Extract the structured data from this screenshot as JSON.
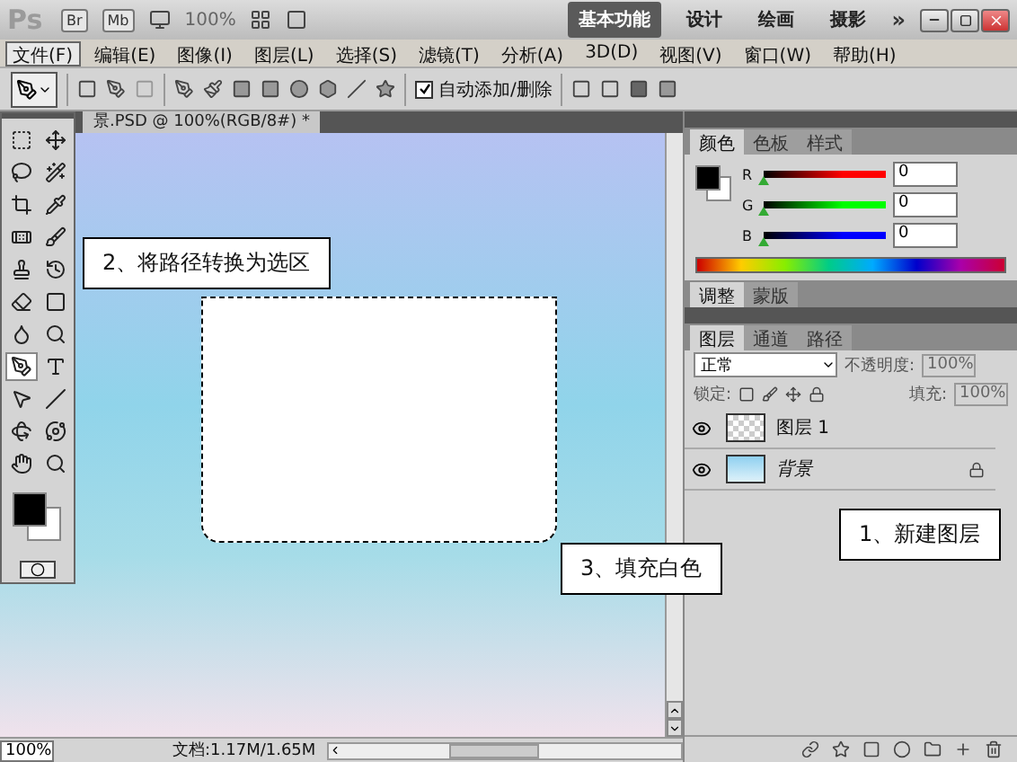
{
  "app_bar": {
    "logo": "Ps",
    "bridge": "Br",
    "mini_bridge": "Mb",
    "zoom": "100%",
    "workspaces": [
      {
        "label": "基本功能",
        "selected": true
      },
      {
        "label": "设计",
        "selected": false
      },
      {
        "label": "绘画",
        "selected": false
      },
      {
        "label": "摄影",
        "selected": false
      }
    ],
    "more": "»"
  },
  "menu": [
    {
      "label": "文件(F)",
      "selected": true
    },
    {
      "label": "编辑(E)",
      "selected": false
    },
    {
      "label": "图像(I)",
      "selected": false
    },
    {
      "label": "图层(L)",
      "selected": false
    },
    {
      "label": "选择(S)",
      "selected": false
    },
    {
      "label": "滤镜(T)",
      "selected": false
    },
    {
      "label": "分析(A)",
      "selected": false
    },
    {
      "label": "3D(D)",
      "selected": false
    },
    {
      "label": "视图(V)",
      "selected": false
    },
    {
      "label": "窗口(W)",
      "selected": false
    },
    {
      "label": "帮助(H)",
      "selected": false
    }
  ],
  "options_bar": {
    "auto_add_delete": {
      "label": "自动添加/删除",
      "checked": true
    }
  },
  "document": {
    "tab_title": "景.PSD @ 100%(RGB/8#) *",
    "zoom": "100%",
    "doc_info": "文档:1.17M/1.65M"
  },
  "annotations": [
    {
      "text": "2、将路径转换为选区"
    },
    {
      "text": "3、填充白色"
    },
    {
      "text": "1、新建图层"
    }
  ],
  "color_panel": {
    "tabs": [
      {
        "label": "颜色",
        "selected": true
      },
      {
        "label": "色板",
        "selected": false
      },
      {
        "label": "样式",
        "selected": false
      }
    ],
    "channels": [
      {
        "label": "R",
        "value": "0",
        "level": 0,
        "color": "#ff0000"
      },
      {
        "label": "G",
        "value": "0",
        "level": 0,
        "color": "#00ff00"
      },
      {
        "label": "B",
        "value": "0",
        "level": 0,
        "color": "#0000ff"
      }
    ]
  },
  "adjust_panel": {
    "tabs": [
      {
        "label": "调整",
        "selected": true
      },
      {
        "label": "蒙版",
        "selected": false
      }
    ]
  },
  "layers_panel": {
    "tabs": [
      {
        "label": "图层",
        "selected": true
      },
      {
        "label": "通道",
        "selected": false
      },
      {
        "label": "路径",
        "selected": false
      }
    ],
    "blend_mode": "正常",
    "opacity_label": "不透明度:",
    "opacity": "100%",
    "lock_label": "锁定:",
    "fill_label": "填充:",
    "fill": "100%",
    "layers": [
      {
        "name": "图层 1",
        "kind": "transparent",
        "visible": true,
        "locked": false,
        "selected": false
      },
      {
        "name": "背景",
        "kind": "gradient",
        "visible": true,
        "locked": true,
        "selected": false
      }
    ]
  }
}
